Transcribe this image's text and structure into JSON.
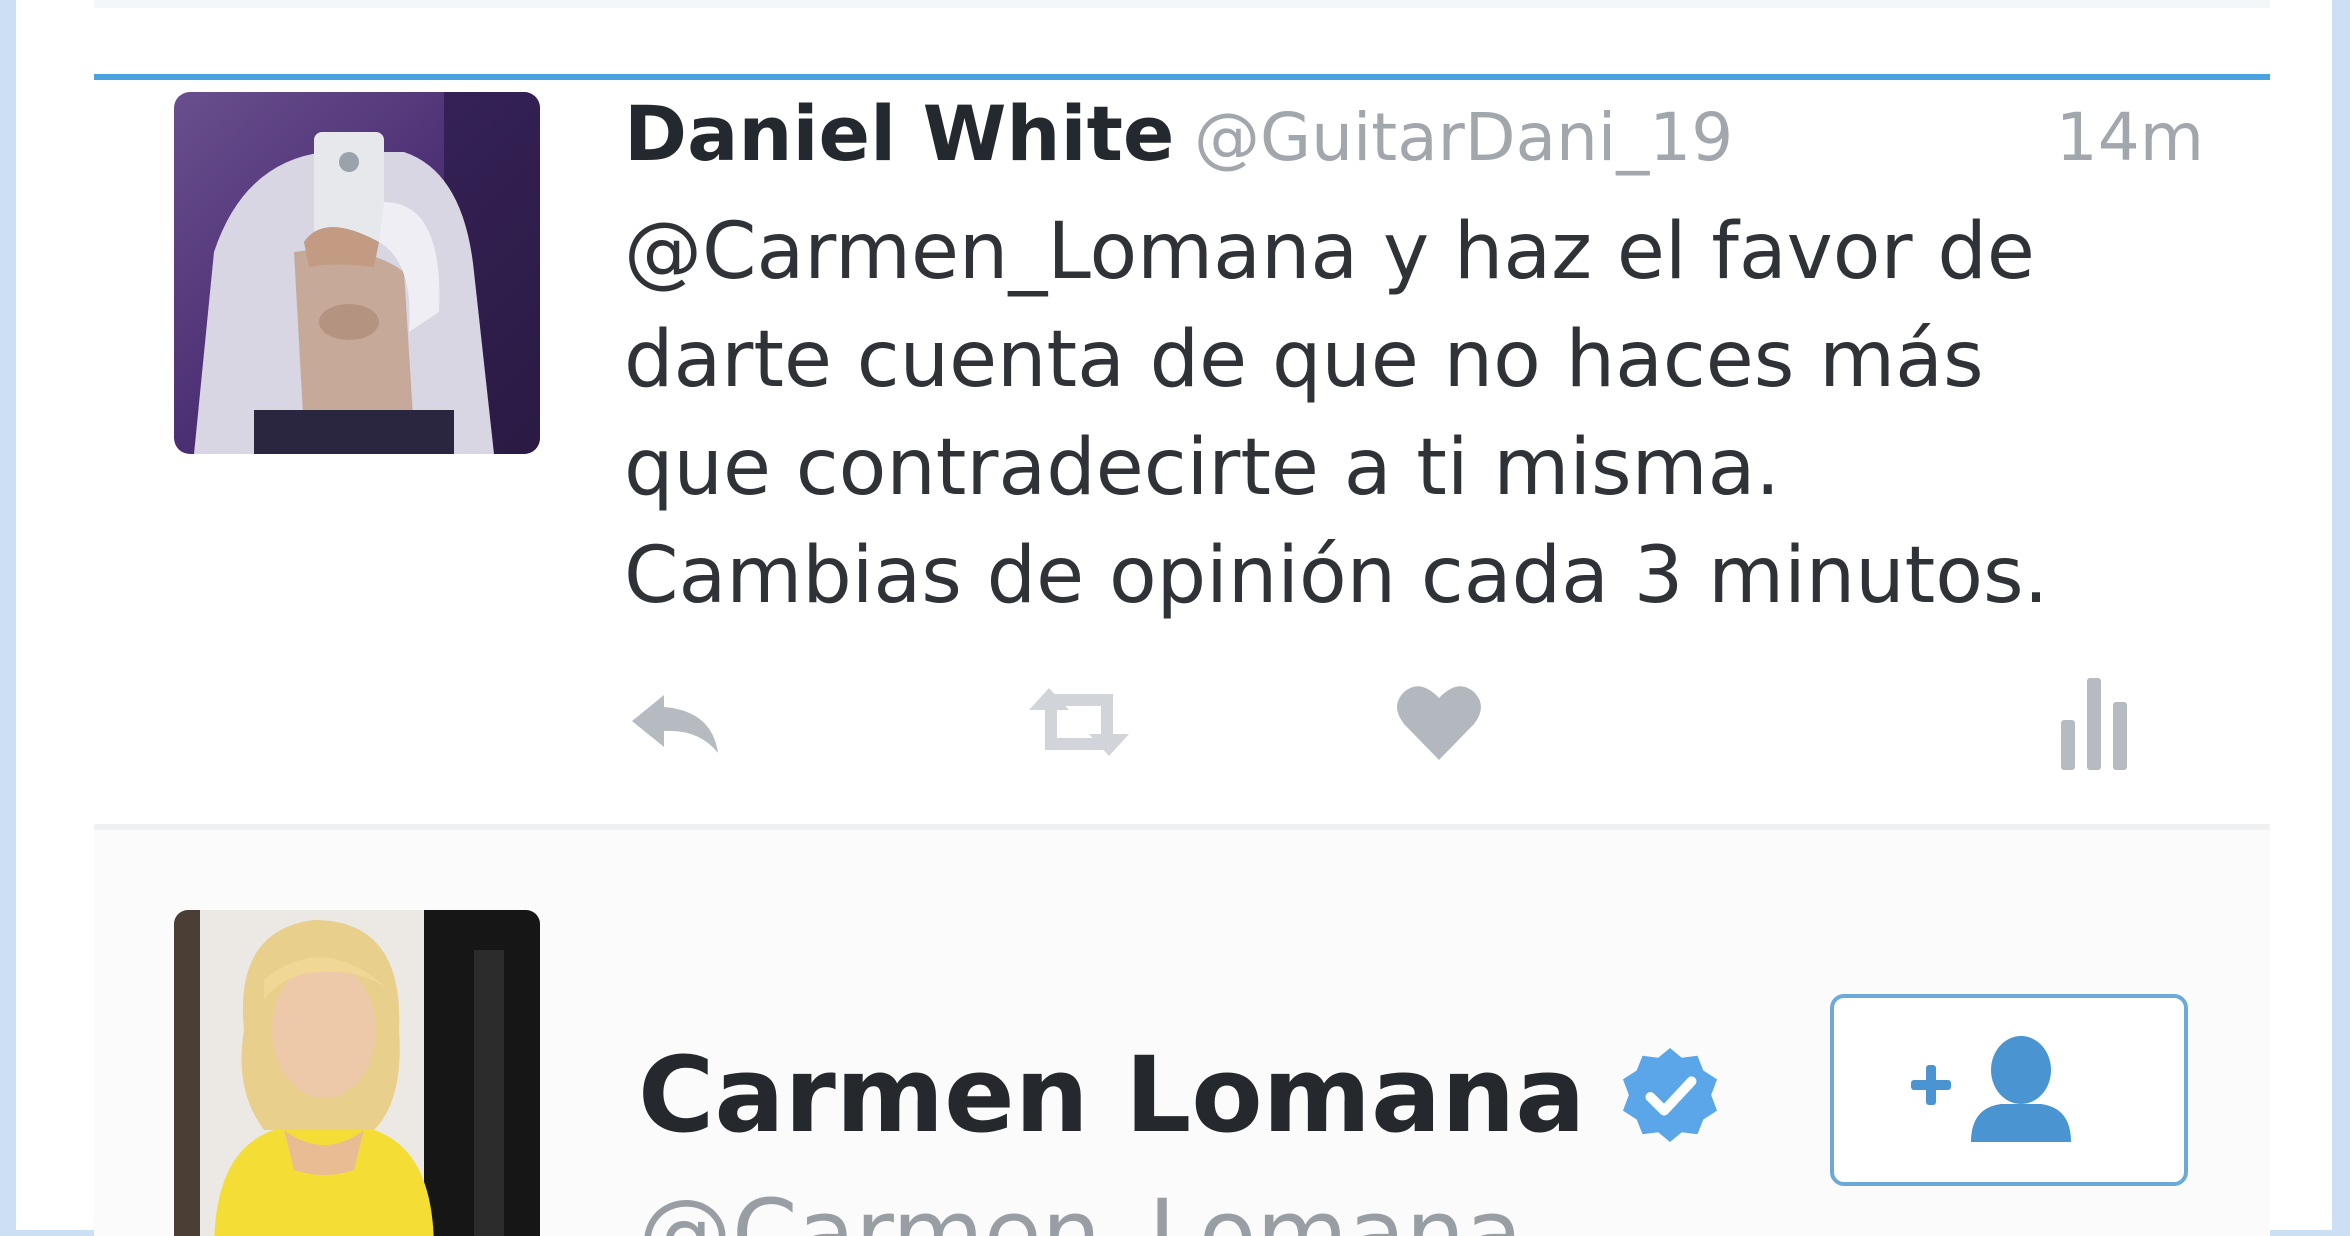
{
  "tweet": {
    "author_name": "Daniel White",
    "author_handle": "@GuitarDani_19",
    "time": "14m",
    "text": "@Carmen_Lomana y haz el favor de\ndarte cuenta de que no haces más\nque contradecirte a ti misma.\nCambias de opinión cada 3 minutos.",
    "actions": {
      "reply_icon": "reply-icon",
      "retweet_icon": "retweet-icon",
      "like_icon": "heart-icon",
      "analytics_icon": "analytics-bars-icon"
    }
  },
  "profile": {
    "name": "Carmen Lomana",
    "handle": "@Carmen_Lomana",
    "verified_icon": "verified-badge-icon",
    "follow_icon": "add-user-icon"
  },
  "colors": {
    "accent_blue": "#4aa3df",
    "verified_blue": "#5aa6e8",
    "text_dark": "#24292f",
    "text_muted": "#a2a7ad",
    "icon_gray": "#b6bbc2"
  }
}
